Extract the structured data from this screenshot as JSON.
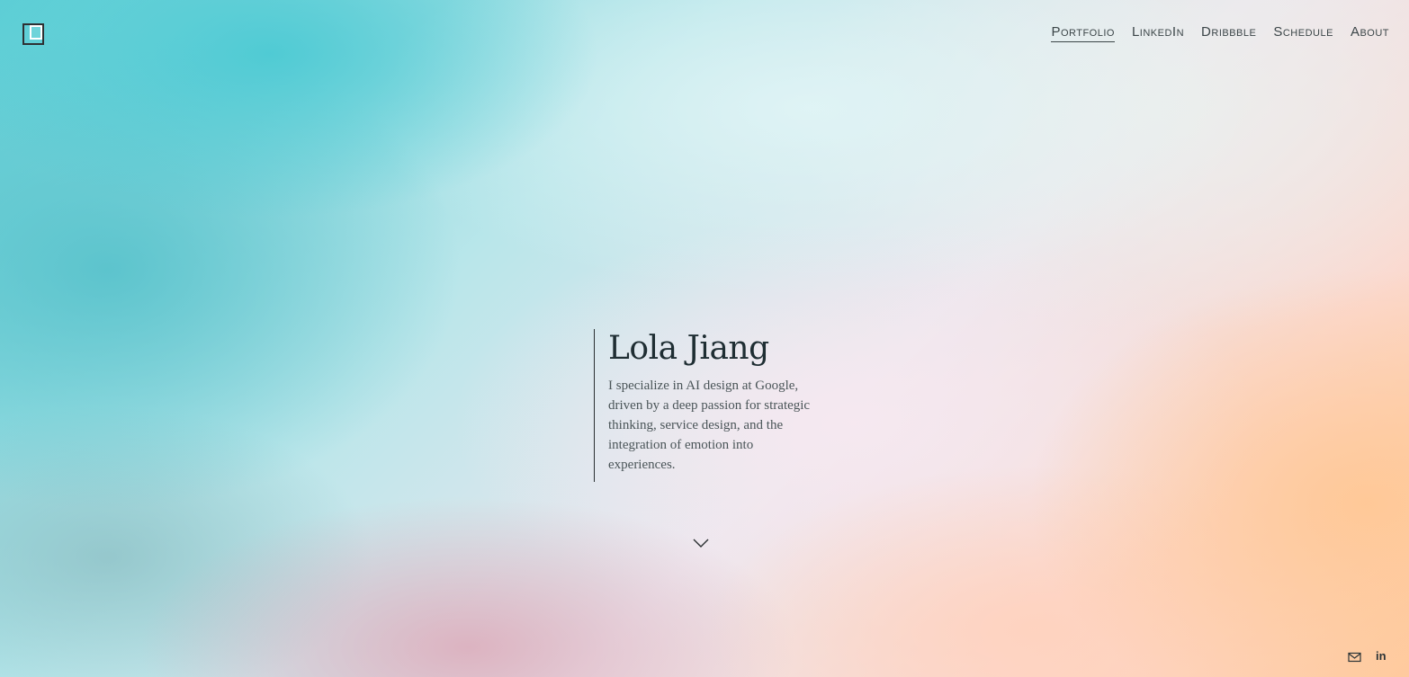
{
  "brand": {
    "logo_icon": "logo-square-icon"
  },
  "nav": {
    "items": [
      {
        "label": "Portfolio",
        "active": true
      },
      {
        "label": "LinkedIn",
        "active": false
      },
      {
        "label": "Dribbble",
        "active": false
      },
      {
        "label": "Schedule",
        "active": false
      },
      {
        "label": "About",
        "active": false
      }
    ]
  },
  "hero": {
    "name": "Lola Jiang",
    "description": "I specialize in AI design at Google, driven by a deep passion for strategic thinking, service design, and the integration of emotion into experiences."
  },
  "scroll": {
    "icon": "chevron-down-icon"
  },
  "social": {
    "email_icon": "email-icon",
    "linkedin_label": "in"
  },
  "colors": {
    "text_dark": "#1f2e33",
    "text_body": "#4a5558",
    "accent_teal": "#5fcfd6",
    "accent_peach": "#ffcba0"
  }
}
